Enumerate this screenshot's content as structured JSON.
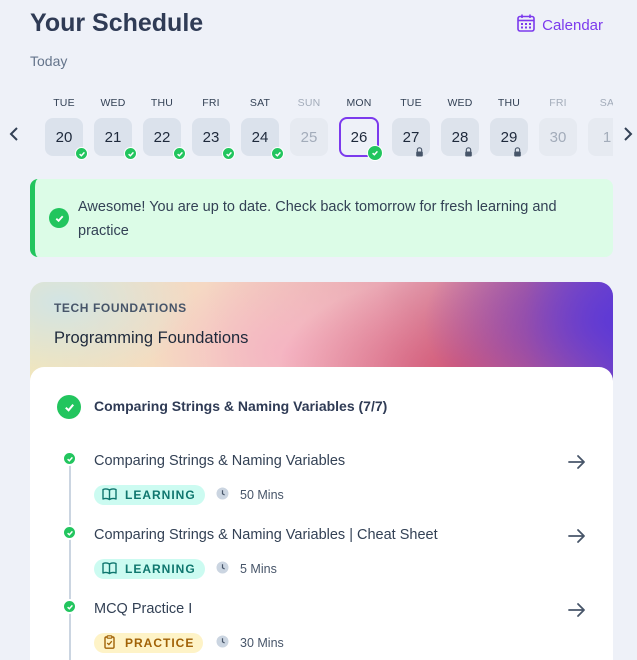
{
  "header": {
    "title": "Your Schedule",
    "calendar_label": "Calendar",
    "today_label": "Today"
  },
  "days": [
    {
      "dow": "TUE",
      "date": "20",
      "state": "done"
    },
    {
      "dow": "WED",
      "date": "21",
      "state": "done"
    },
    {
      "dow": "THU",
      "date": "22",
      "state": "done"
    },
    {
      "dow": "FRI",
      "date": "23",
      "state": "done"
    },
    {
      "dow": "SAT",
      "date": "24",
      "state": "done"
    },
    {
      "dow": "SUN",
      "date": "25",
      "state": "off"
    },
    {
      "dow": "MON",
      "date": "26",
      "state": "selected-done"
    },
    {
      "dow": "TUE",
      "date": "27",
      "state": "locked"
    },
    {
      "dow": "WED",
      "date": "28",
      "state": "locked"
    },
    {
      "dow": "THU",
      "date": "29",
      "state": "locked"
    },
    {
      "dow": "FRI",
      "date": "30",
      "state": "off"
    },
    {
      "dow": "SA",
      "date": "1",
      "state": "off"
    }
  ],
  "alert": {
    "message": "Awesome! You are up to date. Check back tomorrow for fresh learning and practice"
  },
  "course": {
    "kicker": "TECH FOUNDATIONS",
    "title": "Programming Foundations",
    "module": {
      "title": "Comparing Strings & Naming Variables (7/7)",
      "items": [
        {
          "title": "Comparing Strings & Naming Variables",
          "tag": "LEARNING",
          "duration": "50 Mins"
        },
        {
          "title": "Comparing Strings & Naming Variables | Cheat Sheet",
          "tag": "LEARNING",
          "duration": "5 Mins"
        },
        {
          "title": "MCQ Practice I",
          "tag": "PRACTICE",
          "duration": "30 Mins"
        }
      ]
    }
  },
  "colors": {
    "accent": "#7c3aed",
    "success": "#22c55e",
    "alert_bg": "#dcfce7",
    "learning_bg": "#ccfbf1",
    "practice_bg": "#fef3c7"
  },
  "icons": {
    "calendar": "calendar-icon",
    "prev": "chevron-left-icon",
    "next": "chevron-right-icon",
    "done": "check-circle-icon",
    "locked": "lock-icon",
    "go": "arrow-right-icon",
    "learning": "book-icon",
    "practice": "clipboard-icon",
    "time": "clock-icon"
  }
}
